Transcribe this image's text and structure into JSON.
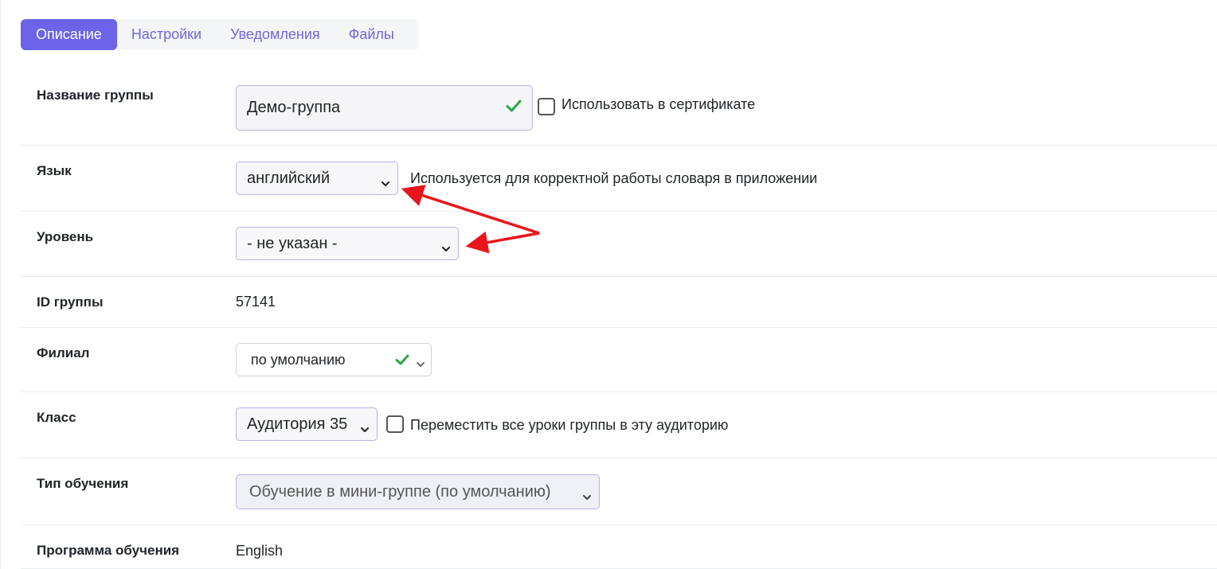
{
  "tabs": [
    {
      "label": "Описание",
      "active": true
    },
    {
      "label": "Настройки",
      "active": false
    },
    {
      "label": "Уведомления",
      "active": false
    },
    {
      "label": "Файлы",
      "active": false
    }
  ],
  "form": {
    "group_name": {
      "label": "Название группы",
      "value": "Демо-группа",
      "checkbox_label": "Использовать в сертификате"
    },
    "language": {
      "label": "Язык",
      "value": "английский",
      "hint": "Используется для корректной работы словаря в приложении"
    },
    "level": {
      "label": "Уровень",
      "value": "- не указан -"
    },
    "group_id": {
      "label": "ID группы",
      "value": "57141"
    },
    "branch": {
      "label": "Филиал",
      "value": "по умолчанию"
    },
    "class": {
      "label": "Класс",
      "value": "Аудитория 35",
      "checkbox_label": "Переместить все уроки группы в эту аудиторию"
    },
    "learning_type": {
      "label": "Тип обучения",
      "value": "Обучение в мини-группе (по умолчанию)"
    },
    "program": {
      "label": "Программа обучения",
      "value": "English"
    }
  },
  "colors": {
    "accent": "#6c63e8",
    "tab_text": "#6f68d8",
    "valid_check": "#28a745",
    "annotation_arrow": "#e8161c"
  },
  "icons": {
    "valid": "check-icon",
    "dropdown": "chevron-down-icon"
  }
}
